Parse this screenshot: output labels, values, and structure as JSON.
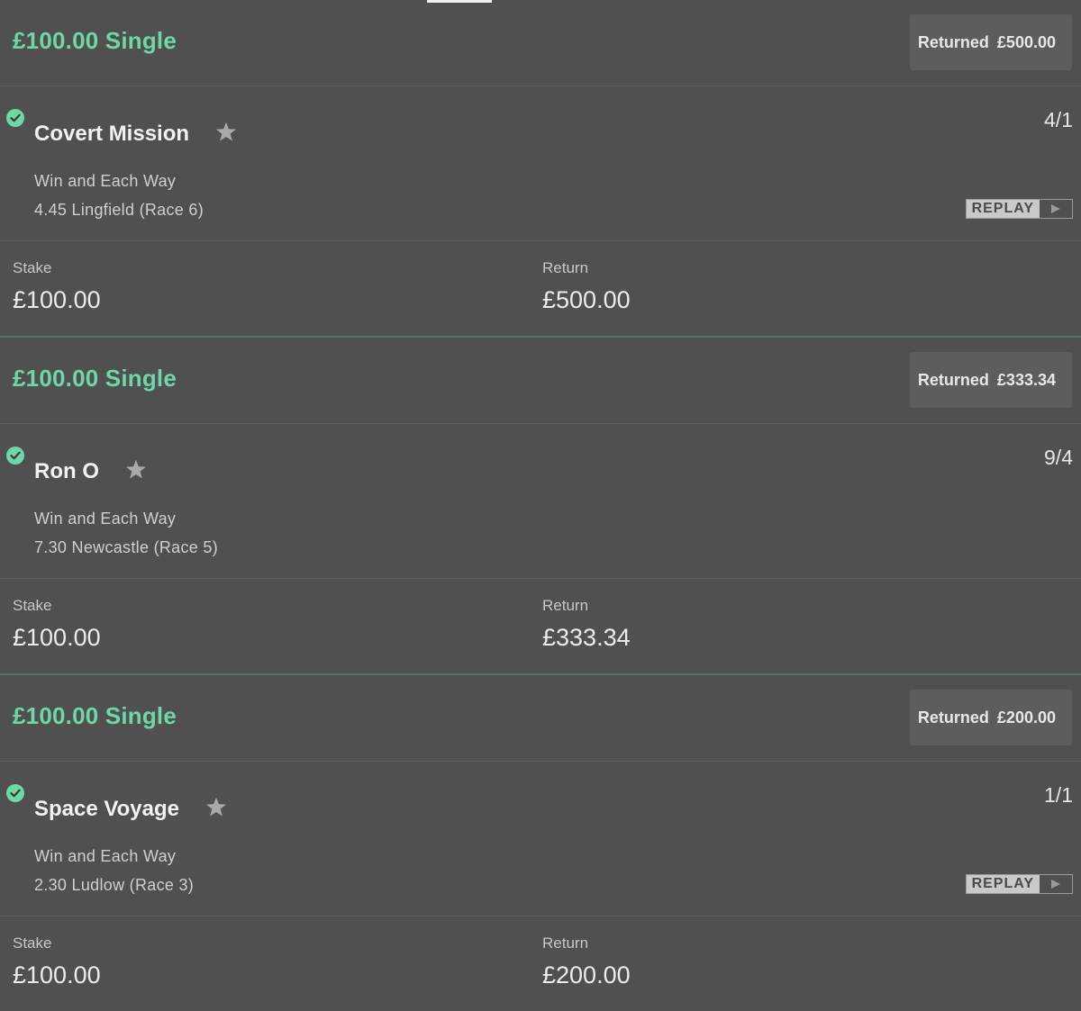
{
  "bets": [
    {
      "title": "£100.00 Single",
      "returned_label": "Returned",
      "returned_amount": "£500.00",
      "selection": {
        "name": "Covert Mission",
        "odds": "4/1",
        "market": "Win and Each Way",
        "event": "4.45 Lingfield (Race 6)",
        "has_replay": true
      },
      "stake_label": "Stake",
      "stake_value": "£100.00",
      "return_label": "Return",
      "return_value": "£500.00"
    },
    {
      "title": "£100.00 Single",
      "returned_label": "Returned",
      "returned_amount": "£333.34",
      "selection": {
        "name": "Ron O",
        "odds": "9/4",
        "market": "Win and Each Way",
        "event": "7.30 Newcastle (Race 5)",
        "has_replay": false
      },
      "stake_label": "Stake",
      "stake_value": "£100.00",
      "return_label": "Return",
      "return_value": "£333.34"
    },
    {
      "title": "£100.00 Single",
      "returned_label": "Returned",
      "returned_amount": "£200.00",
      "selection": {
        "name": "Space Voyage",
        "odds": "1/1",
        "market": "Win and Each Way",
        "event": "2.30 Ludlow (Race 3)",
        "has_replay": true
      },
      "stake_label": "Stake",
      "stake_value": "£100.00",
      "return_label": "Return",
      "return_value": "£200.00"
    }
  ],
  "replay_label": "REPLAY",
  "icons": {
    "status": "check-circle-icon",
    "favourite": "star-icon",
    "replay": "play-icon"
  },
  "colors": {
    "background": "#505050",
    "accent_green": "#6fd6a8",
    "divider_green": "#4a7a66",
    "badge_bg": "#5d5d5d"
  }
}
